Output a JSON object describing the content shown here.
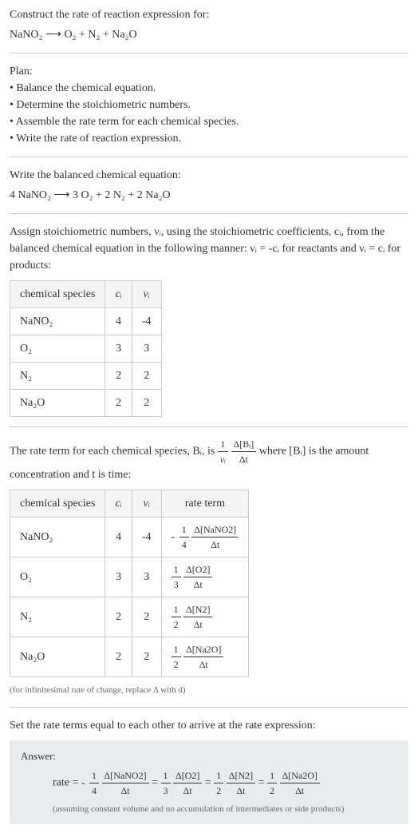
{
  "title": "Construct the rate of reaction expression for:",
  "equation_unbalanced": "NaNO₂ ⟶ O₂ + N₂ + Na₂O",
  "plan_heading": "Plan:",
  "plan_items": [
    "• Balance the chemical equation.",
    "• Determine the stoichiometric numbers.",
    "• Assemble the rate term for each chemical species.",
    "• Write the rate of reaction expression."
  ],
  "balanced_heading": "Write the balanced chemical equation:",
  "equation_balanced": "4 NaNO₂ ⟶ 3 O₂ + 2 N₂ + 2 Na₂O",
  "stoich_intro_1": "Assign stoichiometric numbers, νᵢ, using the stoichiometric coefficients, cᵢ, from the balanced chemical equation in the following manner: νᵢ = -cᵢ for reactants and νᵢ = cᵢ for products:",
  "table1": {
    "headers": [
      "chemical species",
      "cᵢ",
      "νᵢ"
    ],
    "rows": [
      {
        "species": "NaNO₂",
        "c": "4",
        "v": "-4"
      },
      {
        "species": "O₂",
        "c": "3",
        "v": "3"
      },
      {
        "species": "N₂",
        "c": "2",
        "v": "2"
      },
      {
        "species": "Na₂O",
        "c": "2",
        "v": "2"
      }
    ]
  },
  "rate_term_intro_1": "The rate term for each chemical species, Bᵢ, is ",
  "rate_term_frac_left_num": "1",
  "rate_term_frac_left_den": "νᵢ",
  "rate_term_frac_right_num": "Δ[Bᵢ]",
  "rate_term_frac_right_den": "Δt",
  "rate_term_intro_2": " where [Bᵢ] is the amount concentration and t is time:",
  "table2": {
    "headers": [
      "chemical species",
      "cᵢ",
      "νᵢ",
      "rate term"
    ],
    "rows": [
      {
        "species": "NaNO₂",
        "c": "4",
        "v": "-4",
        "sign": "-",
        "coef_num": "1",
        "coef_den": "4",
        "conc_num": "Δ[NaNO2]",
        "conc_den": "Δt"
      },
      {
        "species": "O₂",
        "c": "3",
        "v": "3",
        "sign": "",
        "coef_num": "1",
        "coef_den": "3",
        "conc_num": "Δ[O2]",
        "conc_den": "Δt"
      },
      {
        "species": "N₂",
        "c": "2",
        "v": "2",
        "sign": "",
        "coef_num": "1",
        "coef_den": "2",
        "conc_num": "Δ[N2]",
        "conc_den": "Δt"
      },
      {
        "species": "Na₂O",
        "c": "2",
        "v": "2",
        "sign": "",
        "coef_num": "1",
        "coef_den": "2",
        "conc_num": "Δ[Na2O]",
        "conc_den": "Δt"
      }
    ]
  },
  "infinitesimal_note": "(for infinitesimal rate of change, replace Δ with d)",
  "final_heading": "Set the rate terms equal to each other to arrive at the rate expression:",
  "answer_label": "Answer:",
  "rate_prefix": "rate = ",
  "rate_terms": [
    {
      "sign": "-",
      "coef_num": "1",
      "coef_den": "4",
      "conc_num": "Δ[NaNO2]",
      "conc_den": "Δt"
    },
    {
      "sign": "",
      "coef_num": "1",
      "coef_den": "3",
      "conc_num": "Δ[O2]",
      "conc_den": "Δt"
    },
    {
      "sign": "",
      "coef_num": "1",
      "coef_den": "2",
      "conc_num": "Δ[N2]",
      "conc_den": "Δt"
    },
    {
      "sign": "",
      "coef_num": "1",
      "coef_den": "2",
      "conc_num": "Δ[Na2O]",
      "conc_den": "Δt"
    }
  ],
  "answer_note": "(assuming constant volume and no accumulation of intermediates or side products)"
}
